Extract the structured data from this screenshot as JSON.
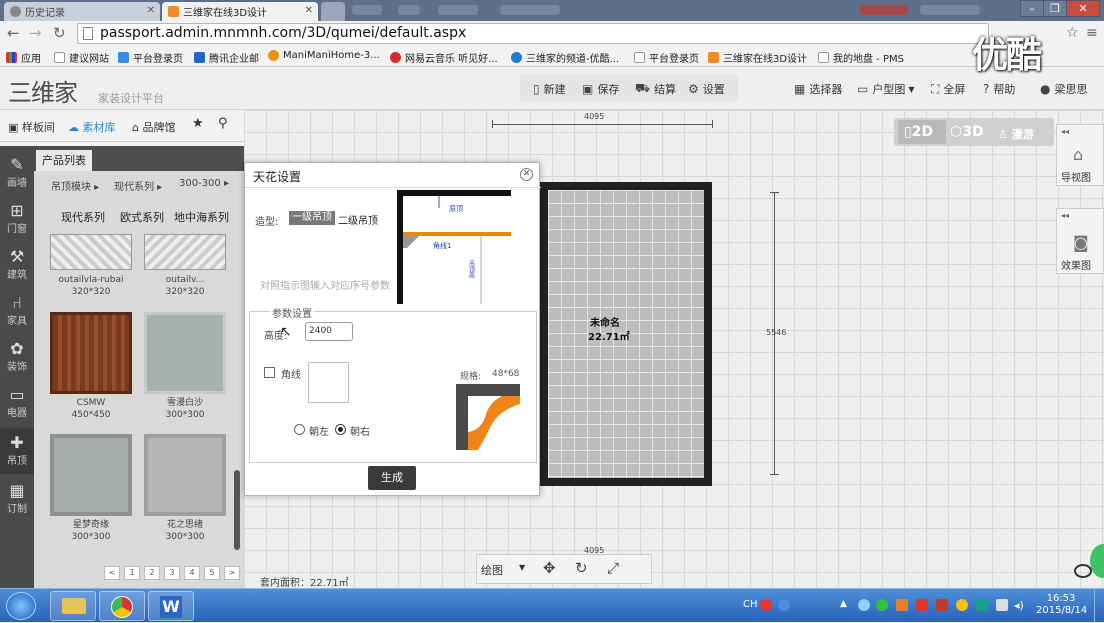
{
  "browser": {
    "tabs": [
      {
        "title": "历史记录",
        "active": false
      },
      {
        "title": "三维家在线3D设计",
        "active": true
      }
    ],
    "url": "passport.admin.mnmnh.com/3D/qumei/default.aspx",
    "bookmarks": [
      "应用",
      "建议网站",
      "平台登录页",
      "腾讯企业邮",
      "ManiManiHome-3...",
      "网易云音乐 听见好...",
      "三维家的频道-优酷...",
      "平台登录页",
      "三维家在线3D设计",
      "我的地盘 - PMS"
    ],
    "watermark": "优酷"
  },
  "app": {
    "logo": "三维家",
    "subtitle": "家装设计平台",
    "toolbar": {
      "new": "新建",
      "save": "保存",
      "checkout": "结算",
      "settings": "设置"
    },
    "right_toolbar": {
      "selector": "选择器",
      "floorplan": "户型图",
      "fullscreen": "全屏",
      "help": "帮助",
      "user": "梁思思"
    }
  },
  "left": {
    "lib_tabs": [
      "样板间",
      "素材库",
      "品牌馆"
    ],
    "side_nav": [
      "画墙",
      "门窗",
      "建筑",
      "家具",
      "装饰",
      "电器",
      "吊顶",
      "订制"
    ],
    "product_list_label": "产品列表",
    "filters": {
      "row1": [
        "吊顶模块",
        "现代系列",
        "300-300"
      ],
      "row2": [
        "现代系列",
        "欧式系列",
        "地中海系列"
      ]
    },
    "products": [
      {
        "name": "outailvla-rubai",
        "size": "320*320"
      },
      {
        "name": "outailv...",
        "size": "320*320"
      },
      {
        "name": "CSMW",
        "size": "450*450"
      },
      {
        "name": "雪漫白沙",
        "size": "300*300"
      },
      {
        "name": "星梦奇缘",
        "size": "300*300"
      },
      {
        "name": "花之思绪",
        "size": "300*300"
      }
    ],
    "pages": [
      "<",
      "1",
      "2",
      "3",
      "4",
      "5",
      ">"
    ]
  },
  "canvas": {
    "view_modes": [
      "2D",
      "3D",
      "漫游"
    ],
    "right_buttons": [
      "导视图",
      "效果图"
    ],
    "width_dim": "4095",
    "height_dim": "5546",
    "bottom_dim": "4095",
    "room_name": "未命名",
    "room_area": "22.71㎡",
    "bottom_tools": {
      "draw": "绘图"
    },
    "status_area": "套内面积：22.71㎡"
  },
  "dialog": {
    "title": "天花设置",
    "shape_label": "造型:",
    "shape_options": [
      "一级吊顶",
      "二级吊顶"
    ],
    "shape_selected": "一级吊顶",
    "hint": "对照指示图输入对应序号参数",
    "diagram": {
      "label_top": "原顶",
      "label_corner": "角线1",
      "label_side": "吊顶高"
    },
    "params_title": "参数设置",
    "height_label": "高度:",
    "height_value": "2400",
    "corner_label": "角线",
    "corner_checked": false,
    "spec_label": "规格:",
    "spec_value": "48*68",
    "directions": [
      "朝左",
      "朝右"
    ],
    "direction_selected": "朝右",
    "generate": "生成"
  },
  "taskbar": {
    "ime": "CH",
    "time": "16:53",
    "date": "2015/8/14"
  }
}
